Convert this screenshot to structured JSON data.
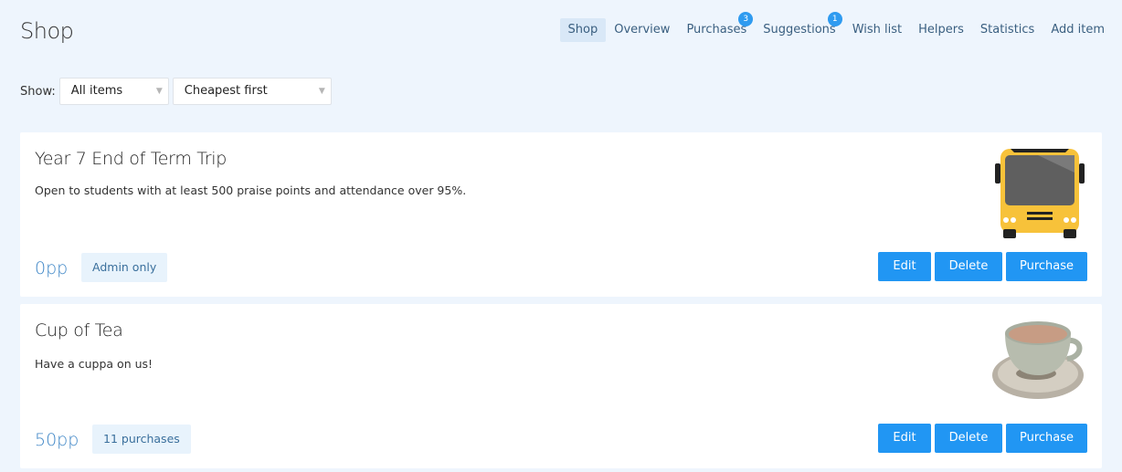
{
  "header": {
    "title": "Shop"
  },
  "nav": [
    {
      "label": "Shop",
      "active": true,
      "badge": ""
    },
    {
      "label": "Overview",
      "active": false,
      "badge": ""
    },
    {
      "label": "Purchases",
      "active": false,
      "badge": "3"
    },
    {
      "label": "Suggestions",
      "active": false,
      "badge": "1"
    },
    {
      "label": "Wish list",
      "active": false,
      "badge": ""
    },
    {
      "label": "Helpers",
      "active": false,
      "badge": ""
    },
    {
      "label": "Statistics",
      "active": false,
      "badge": ""
    },
    {
      "label": "Add item",
      "active": false,
      "badge": ""
    }
  ],
  "filters": {
    "show_label": "Show:",
    "show_value": "All items",
    "sort_value": "Cheapest first"
  },
  "items": [
    {
      "title": "Year 7 End of Term Trip",
      "description": "Open to students with at least 500 praise points and attendance over 95%.",
      "price": "0pp",
      "tag": "Admin only",
      "image": "school-bus-icon",
      "actions": {
        "edit": "Edit",
        "delete": "Delete",
        "purchase": "Purchase"
      }
    },
    {
      "title": "Cup of Tea",
      "description": "Have a cuppa on us!",
      "price": "50pp",
      "tag": "11 purchases",
      "image": "tea-cup-icon",
      "actions": {
        "edit": "Edit",
        "delete": "Delete",
        "purchase": "Purchase"
      }
    }
  ],
  "colors": {
    "page_bg": "#eef5fd",
    "accent": "#2196f3",
    "badge": "#2f9bf0",
    "price": "#3d85c6",
    "bus_yellow": "#f7c23a"
  }
}
